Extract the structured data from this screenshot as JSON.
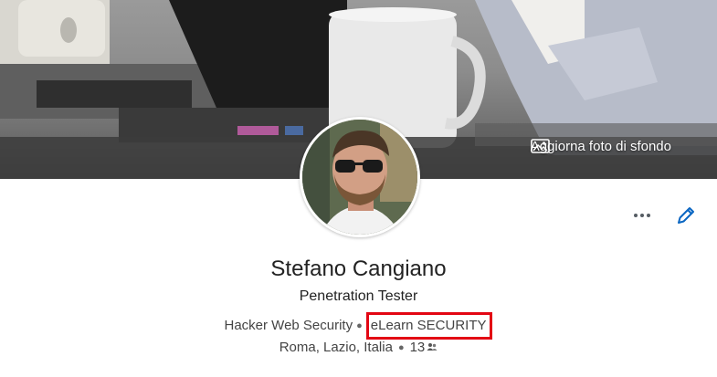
{
  "banner": {
    "update_label": "Aggiorna foto di sfondo",
    "icon": "image-icon"
  },
  "profile": {
    "name": "Stefano Cangiano",
    "headline": "Penetration Tester",
    "employer": "Hacker Web Security",
    "company": "eLearn SECURITY",
    "location": "Roma, Lazio, Italia",
    "connections": "13",
    "connections_icon": "people-icon"
  },
  "actions": {
    "more_icon": "more-icon",
    "edit_icon": "pencil-icon"
  },
  "colors": {
    "highlight": "#e30613",
    "edit_blue": "#0a66c2"
  }
}
